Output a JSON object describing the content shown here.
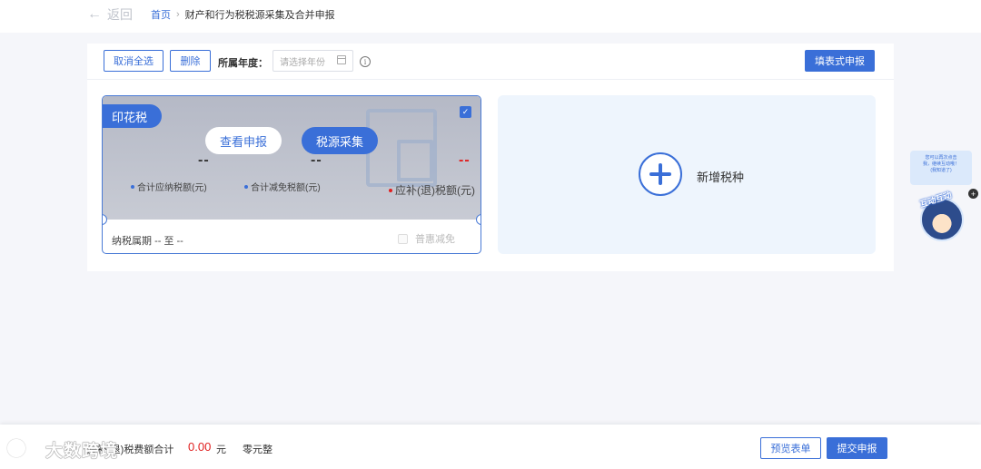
{
  "nav": {
    "back_label": "返回",
    "breadcrumb_home": "首页",
    "breadcrumb_current": "财产和行为税税源采集及合并申报"
  },
  "toolbar": {
    "deselect_all": "取消全选",
    "delete": "删除",
    "year_label": "所属年度：",
    "year_placeholder": "请选择年份",
    "form_report": "填表式申报"
  },
  "tax_card": {
    "tax_name": "印花税",
    "view_button": "查看申报",
    "collect_button": "税源采集",
    "payable_value": "--",
    "payable_label": "合计应纳税额(元)",
    "reduction_value": "--",
    "reduction_label": "合计减免税额(元)",
    "refund_value": "--",
    "refund_label": "应补(退)税额(元)",
    "period_label": "纳税属期",
    "period_value": "-- 至 --",
    "discount_label": "普惠减免",
    "checked": true
  },
  "add_card": {
    "label": "新增税种"
  },
  "assistant": {
    "bubble_line1": "您可以再次点击",
    "bubble_line2": "我，继续互动哦！",
    "bubble_line3": "(我知道了)",
    "name": "互动互动"
  },
  "footer": {
    "total_label": "应补(退)税费额合计",
    "total_amount": "0.00",
    "total_unit": "元",
    "total_words": "零元整",
    "preview_button": "预览表单",
    "submit_button": "提交申报",
    "watermark_text": "大数跨境"
  },
  "colors": {
    "primary": "#3a6fd8",
    "danger": "#e02020",
    "background": "#f5f6fa"
  }
}
